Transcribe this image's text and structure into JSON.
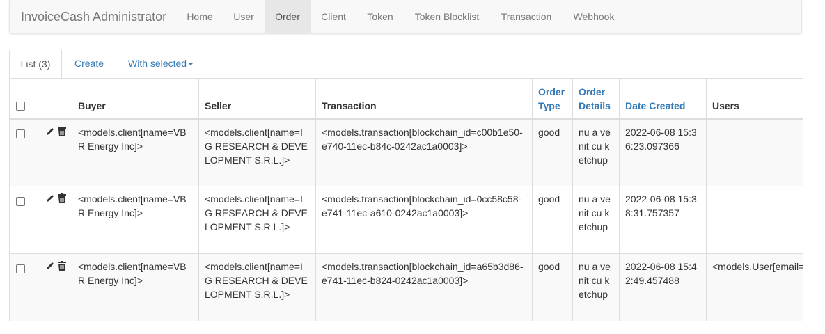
{
  "navbar": {
    "brand": "InvoiceCash Administrator",
    "items": [
      {
        "label": "Home"
      },
      {
        "label": "User"
      },
      {
        "label": "Order"
      },
      {
        "label": "Client"
      },
      {
        "label": "Token"
      },
      {
        "label": "Token Blocklist"
      },
      {
        "label": "Transaction"
      },
      {
        "label": "Webhook"
      }
    ],
    "active": "Order"
  },
  "tabs": {
    "list": "List (3)",
    "create": "Create",
    "with_selected": "With selected"
  },
  "table": {
    "headers": {
      "buyer": "Buyer",
      "seller": "Seller",
      "transaction": "Transaction",
      "order_type": "Order Type",
      "order_details": "Order Details",
      "date_created": "Date Created",
      "users": "Users"
    },
    "rows": [
      {
        "buyer": "<models.client[name=VBR Energy Inc]>",
        "seller": "<models.client[name=IG RESEARCH & DEVELOPMENT S.R.L.]>",
        "transaction": "<models.transaction[blockchain_id=c00b1e50-e740-11ec-b84c-0242ac1a0003]>",
        "order_type": "good",
        "order_details": "nu a venit cu ketchup",
        "date_created": "2022-06-08 15:36:23.097366",
        "users": ""
      },
      {
        "buyer": "<models.client[name=VBR Energy Inc]>",
        "seller": "<models.client[name=IG RESEARCH & DEVELOPMENT S.R.L.]>",
        "transaction": "<models.transaction[blockchain_id=0cc58c58-e741-11ec-a610-0242ac1a0003]>",
        "order_type": "good",
        "order_details": "nu a venit cu ketchup",
        "date_created": "2022-06-08 15:38:31.757357",
        "users": ""
      },
      {
        "buyer": "<models.client[name=VBR Energy Inc]>",
        "seller": "<models.client[name=IG RESEARCH & DEVELOPMENT S.R.L.]>",
        "transaction": "<models.transaction[blockchain_id=a65b3d86-e741-11ec-b824-0242ac1a0003]>",
        "order_type": "good",
        "order_details": "nu a venit cu ketchup",
        "date_created": "2022-06-08 15:42:49.457488",
        "users": "<models.User[email="
      }
    ]
  },
  "colors": {
    "link": "#337ab7",
    "navbar_bg": "#f8f8f8",
    "active_nav_bg": "#e7e7e7",
    "stripe": "#f9f9f9"
  }
}
